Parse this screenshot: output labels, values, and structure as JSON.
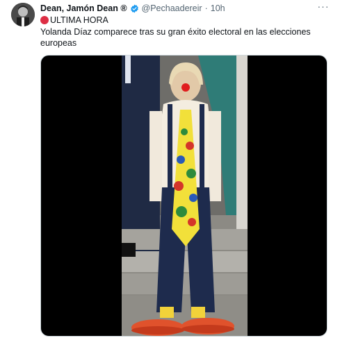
{
  "tweet": {
    "author_name": "Dean, Jamón Dean ®",
    "handle": "@Pechaadereir",
    "separator": "·",
    "time": "10h",
    "more_label": "···",
    "line1": "ULTIMA HORA",
    "body": "Yolanda Díaz comparece tras su gran éxito electoral en las elecciones europeas"
  },
  "colors": {
    "accent": "#1d9bf0",
    "red_circle": "#dd2e44",
    "text_primary": "#0f1419",
    "text_secondary": "#536471"
  },
  "icons": {
    "verified": "verified-badge-icon",
    "more": "more-icon",
    "red_circle": "red-circle-emoji-icon"
  }
}
